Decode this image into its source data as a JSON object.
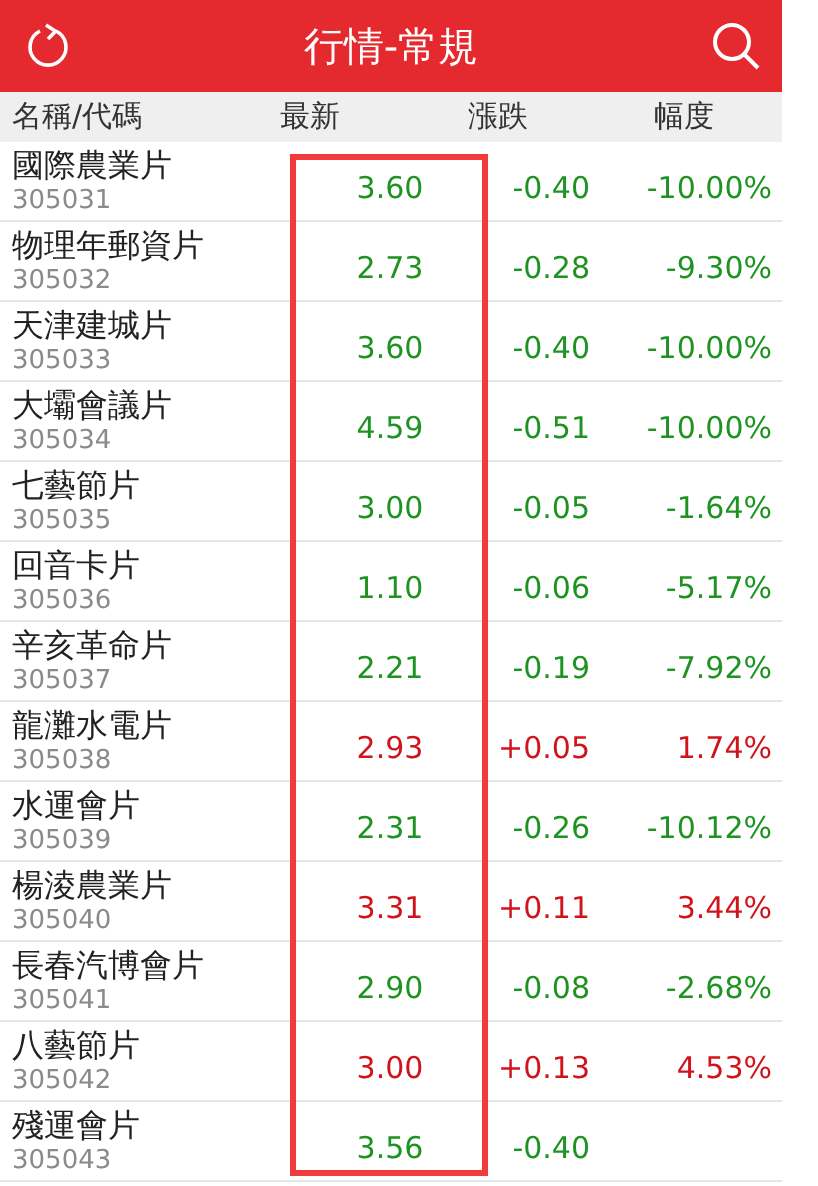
{
  "header": {
    "title": "行情-常規"
  },
  "columns": [
    {
      "label": "名稱/代碼",
      "highlighted": false
    },
    {
      "label": "最新",
      "highlighted": true
    },
    {
      "label": "漲跌",
      "highlighted": false
    },
    {
      "label": "幅度",
      "highlighted": false
    }
  ],
  "rows": [
    {
      "name": "國際農業片",
      "code": "305031",
      "latest": "3.60",
      "change": "-0.40",
      "percent": "-10.00%",
      "color": "#1f9322"
    },
    {
      "name": "物理年郵資片",
      "code": "305032",
      "latest": "2.73",
      "change": "-0.28",
      "percent": "-9.30%",
      "color": "#1f9322"
    },
    {
      "name": "天津建城片",
      "code": "305033",
      "latest": "3.60",
      "change": "-0.40",
      "percent": "-10.00%",
      "color": "#1f9322"
    },
    {
      "name": "大壩會議片",
      "code": "305034",
      "latest": "4.59",
      "change": "-0.51",
      "percent": "-10.00%",
      "color": "#1f9322"
    },
    {
      "name": "七藝節片",
      "code": "305035",
      "latest": "3.00",
      "change": "-0.05",
      "percent": "-1.64%",
      "color": "#1f9322"
    },
    {
      "name": "回音卡片",
      "code": "305036",
      "latest": "1.10",
      "change": "-0.06",
      "percent": "-5.17%",
      "color": "#1f9322"
    },
    {
      "name": "辛亥革命片",
      "code": "305037",
      "latest": "2.21",
      "change": "-0.19",
      "percent": "-7.92%",
      "color": "#1f9322"
    },
    {
      "name": "龍灘水電片",
      "code": "305038",
      "latest": "2.93",
      "change": "+0.05",
      "percent": "1.74%",
      "color": "#d0141c"
    },
    {
      "name": "水運會片",
      "code": "305039",
      "latest": "2.31",
      "change": "-0.26",
      "percent": "-10.12%",
      "color": "#1f9322"
    },
    {
      "name": "楊淩農業片",
      "code": "305040",
      "latest": "3.31",
      "change": "+0.11",
      "percent": "3.44%",
      "color": "#d0141c"
    },
    {
      "name": "長春汽博會片",
      "code": "305041",
      "latest": "2.90",
      "change": "-0.08",
      "percent": "-2.68%",
      "color": "#1f9322"
    },
    {
      "name": "八藝節片",
      "code": "305042",
      "latest": "3.00",
      "change": "+0.13",
      "percent": "4.53%",
      "color": "#d0141c"
    },
    {
      "name": "殘運會片",
      "code": "305043",
      "latest": "3.56",
      "change": "-0.40",
      "color": "#1f9322"
    }
  ]
}
